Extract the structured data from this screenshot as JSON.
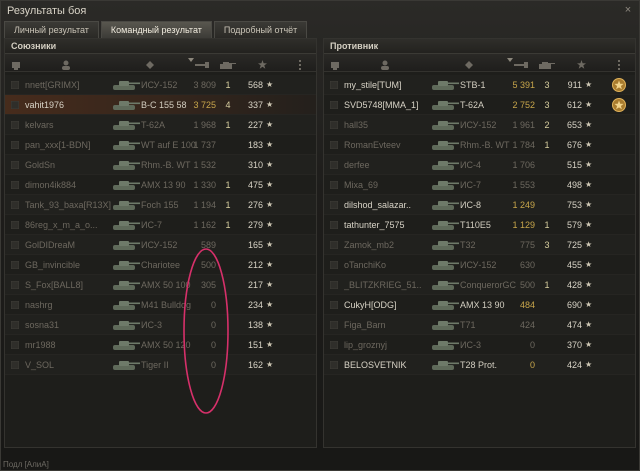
{
  "window": {
    "title": "Результаты боя",
    "close_glyph": "×"
  },
  "tabs": [
    {
      "label": "Личный результат",
      "active": false
    },
    {
      "label": "Командный результат",
      "active": true
    },
    {
      "label": "Подробный отчёт",
      "active": false
    }
  ],
  "left_panel": {
    "title": "Союзники",
    "rows": [
      {
        "name": "nnett[GRIMX]",
        "vehicle": "ИСУ-152",
        "damage": "3 809",
        "kills": "1",
        "xp": "568",
        "state": "dead",
        "mine": false
      },
      {
        "name": "vahit1976",
        "vehicle": "B-C 155 58",
        "damage": "3 725",
        "kills": "4",
        "xp": "337",
        "state": "alive",
        "mine": true
      },
      {
        "name": "kelvars",
        "vehicle": "T-62A",
        "damage": "1 968",
        "kills": "1",
        "xp": "227",
        "state": "dead",
        "mine": false
      },
      {
        "name": "pan_xxx[1-BDN]",
        "vehicle": "WT auf E 100",
        "damage": "1 737",
        "kills": "",
        "xp": "183",
        "state": "dead",
        "mine": false
      },
      {
        "name": "GoldSn",
        "vehicle": "Rhm.-B. WT",
        "damage": "1 532",
        "kills": "",
        "xp": "310",
        "state": "dead",
        "mine": false
      },
      {
        "name": "dimon4ik884",
        "vehicle": "AMX 13 90",
        "damage": "1 330",
        "kills": "1",
        "xp": "475",
        "state": "dead",
        "mine": false
      },
      {
        "name": "Tank_93_baxa[R13X]",
        "vehicle": "Foch 155",
        "damage": "1 194",
        "kills": "1",
        "xp": "276",
        "state": "dead",
        "mine": false
      },
      {
        "name": "86reg_x_m_a_o...",
        "vehicle": "ИС-7",
        "damage": "1 162",
        "kills": "1",
        "xp": "279",
        "state": "dead",
        "mine": false
      },
      {
        "name": "GolDIDreaM",
        "vehicle": "ИСУ-152",
        "damage": "589",
        "kills": "",
        "xp": "165",
        "state": "dead",
        "mine": false
      },
      {
        "name": "GB_invincible",
        "vehicle": "Chariotee",
        "damage": "500",
        "kills": "",
        "xp": "212",
        "state": "dead",
        "mine": false
      },
      {
        "name": "S_Fox[BALL8]",
        "vehicle": "AMX 50 100",
        "damage": "305",
        "kills": "",
        "xp": "217",
        "state": "dead",
        "mine": false
      },
      {
        "name": "nashrg",
        "vehicle": "M41 Bulldog",
        "damage": "0",
        "kills": "",
        "xp": "234",
        "state": "dead",
        "mine": false
      },
      {
        "name": "sosna31",
        "vehicle": "ИС-3",
        "damage": "0",
        "kills": "",
        "xp": "138",
        "state": "dead",
        "mine": false
      },
      {
        "name": "mr1988",
        "vehicle": "AMX 50 120",
        "damage": "0",
        "kills": "",
        "xp": "151",
        "state": "dead",
        "mine": false
      },
      {
        "name": "V_SOL",
        "vehicle": "Tiger II",
        "damage": "0",
        "kills": "",
        "xp": "162",
        "state": "dead",
        "mine": false
      }
    ]
  },
  "right_panel": {
    "title": "Противник",
    "rows": [
      {
        "name": "my_stile[TUM]",
        "vehicle": "STB-1",
        "damage": "5 391",
        "kills": "3",
        "xp": "911",
        "state": "alive",
        "medal": true
      },
      {
        "name": "SVD5748[MMA_1]",
        "vehicle": "T-62A",
        "damage": "2 752",
        "kills": "3",
        "xp": "612",
        "state": "alive",
        "medal": true
      },
      {
        "name": "hall35",
        "vehicle": "ИСУ-152",
        "damage": "1 961",
        "kills": "2",
        "xp": "653",
        "state": "dead",
        "medal": false
      },
      {
        "name": "RomanEvteev",
        "vehicle": "Rhm.-B. WT",
        "damage": "1 784",
        "kills": "1",
        "xp": "676",
        "state": "dead",
        "medal": false
      },
      {
        "name": "derfee",
        "vehicle": "ИС-4",
        "damage": "1 706",
        "kills": "",
        "xp": "515",
        "state": "dead",
        "medal": false
      },
      {
        "name": "Mixa_69",
        "vehicle": "ИС-7",
        "damage": "1 553",
        "kills": "",
        "xp": "498",
        "state": "dead",
        "medal": false
      },
      {
        "name": "dilshod_salazar..",
        "vehicle": "ИС-8",
        "damage": "1 249",
        "kills": "",
        "xp": "753",
        "state": "alive",
        "medal": false
      },
      {
        "name": "tathunter_7575",
        "vehicle": "T110E5",
        "damage": "1 129",
        "kills": "1",
        "xp": "579",
        "state": "alive",
        "medal": false
      },
      {
        "name": "Zamok_mb2",
        "vehicle": "T32",
        "damage": "775",
        "kills": "3",
        "xp": "725",
        "state": "dead",
        "medal": false
      },
      {
        "name": "oTanchiKo",
        "vehicle": "ИСУ-152",
        "damage": "630",
        "kills": "",
        "xp": "455",
        "state": "dead",
        "medal": false
      },
      {
        "name": "_BLITZKRIEG_51..",
        "vehicle": "ConquerorGC",
        "damage": "500",
        "kills": "1",
        "xp": "428",
        "state": "dead",
        "medal": false
      },
      {
        "name": "CukyH[ODG]",
        "vehicle": "AMX 13 90",
        "damage": "484",
        "kills": "",
        "xp": "690",
        "state": "alive",
        "medal": false
      },
      {
        "name": "Figa_Barn",
        "vehicle": "T71",
        "damage": "424",
        "kills": "",
        "xp": "474",
        "state": "dead",
        "medal": false
      },
      {
        "name": "lip_groznyj",
        "vehicle": "ИС-3",
        "damage": "0",
        "kills": "",
        "xp": "370",
        "state": "dead",
        "medal": false
      },
      {
        "name": "BELOSVETNIK",
        "vehicle": "T28 Prot.",
        "damage": "0",
        "kills": "",
        "xp": "424",
        "state": "alive",
        "medal": false
      }
    ]
  },
  "footer": {
    "text": "Подл [АлиА]"
  },
  "colors": {
    "accent_damage": "#c8a64b",
    "annotation_ellipse": "#d6306a"
  }
}
